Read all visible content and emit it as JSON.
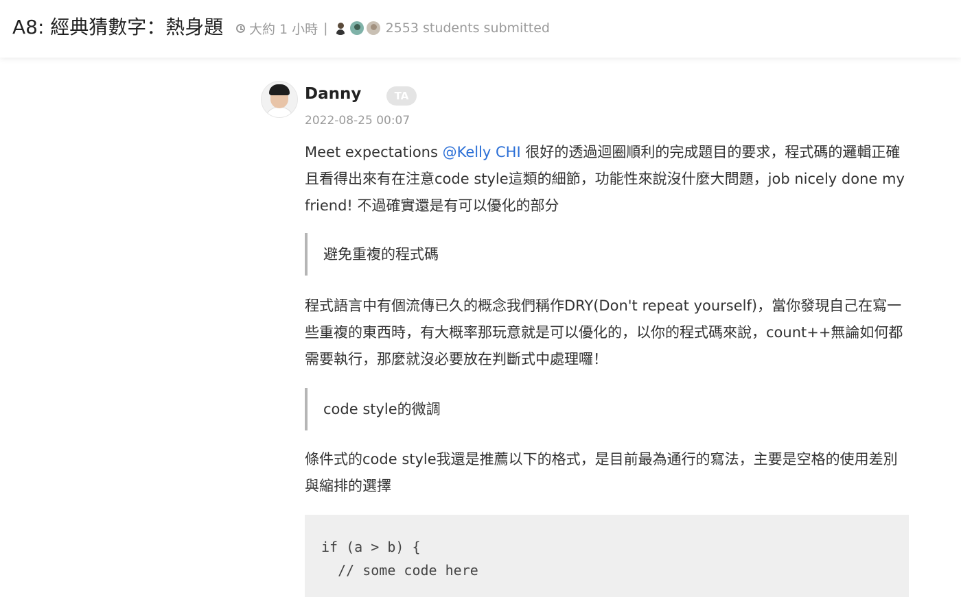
{
  "header": {
    "title": "A8: 經典猜數字：熱身題",
    "duration": "大約 1 小時",
    "separator": "|",
    "submitted": "2553 students submitted"
  },
  "comment": {
    "author": "Danny",
    "role_badge": "TA",
    "date": "2022-08-25 00:07",
    "p1_before": "Meet expectations ",
    "mention": "@Kelly CHI",
    "p1_after": " 很好的透過迴圈順利的完成題目的要求，程式碼的邏輯正確且看得出來有在注意code style這類的細節，功能性來說沒什麼大問題，job nicely done my friend! 不過確實還是有可以優化的部分",
    "quote1": "避免重複的程式碼",
    "p2": "程式語言中有個流傳已久的概念我們稱作DRY(Don't repeat yourself)，當你發現自己在寫一些重複的東西時，有大概率那玩意就是可以優化的，以你的程式碼來說，count++無論如何都需要執行，那麼就沒必要放在判斷式中處理囉！",
    "quote2": "code style的微調",
    "p3": "條件式的code style我還是推薦以下的格式，是目前最為通行的寫法，主要是空格的使用差別與縮排的選擇",
    "code": "if (a > b) {\n  // some code here"
  },
  "colors": {
    "mention": "#2b6fd6",
    "badge_bg": "#e4e4e4",
    "code_bg": "#efefef",
    "quote_border": "#b5b5b5"
  },
  "icons": {
    "duration": "clock-icon"
  }
}
